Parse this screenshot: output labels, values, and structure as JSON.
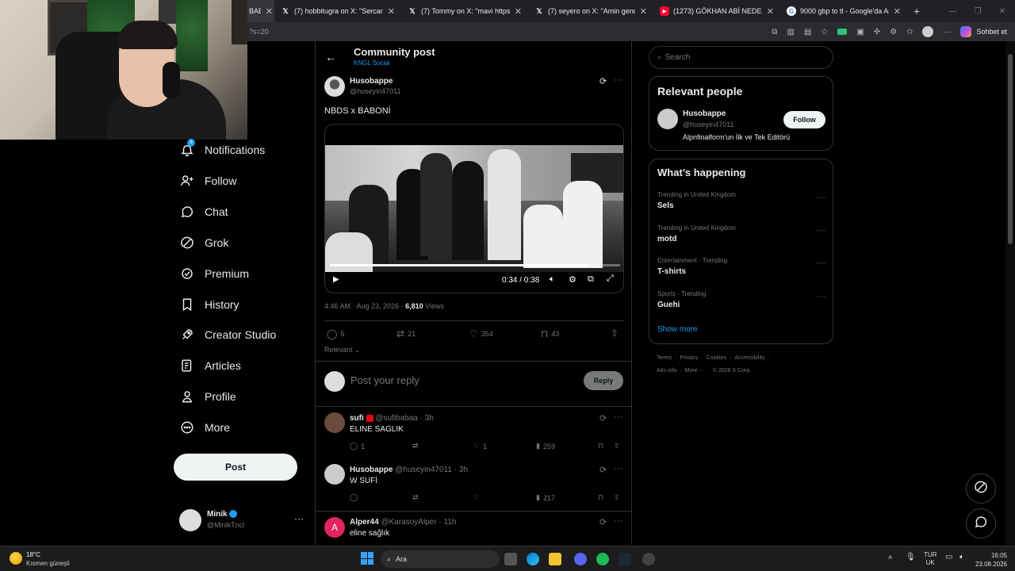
{
  "browser": {
    "tabs": [
      {
        "title": "BABO",
        "icon": "x"
      },
      {
        "title": "(7) hobbitugra on X: \"Sercantall ya",
        "icon": "x"
      },
      {
        "title": "(7) Tommy on X: \"mavi https://t.co",
        "icon": "x"
      },
      {
        "title": "(7) seyero on X: \"Amin gencler😂😂",
        "icon": "x"
      },
      {
        "title": "(1273) GÖKHAN ABİ NEDEN HAK",
        "icon": "youtube"
      },
      {
        "title": "9000 gbp to tl - Google'da Ara",
        "icon": "google"
      }
    ],
    "new_tab": "+",
    "url_fragment": "?s=20",
    "chat_label": "Sohbet et"
  },
  "sidebar": {
    "items": [
      {
        "label": "Notifications",
        "icon": "bell-icon"
      },
      {
        "label": "Follow",
        "icon": "person-plus-icon"
      },
      {
        "label": "Chat",
        "icon": "chat-icon"
      },
      {
        "label": "Grok",
        "icon": "grok-icon"
      },
      {
        "label": "Premium",
        "icon": "verified-icon"
      },
      {
        "label": "History",
        "icon": "bookmark-icon"
      },
      {
        "label": "Creator Studio",
        "icon": "rocket-icon"
      },
      {
        "label": "Articles",
        "icon": "article-icon"
      },
      {
        "label": "Profile",
        "icon": "person-icon"
      },
      {
        "label": "More",
        "icon": "more-circle-icon"
      }
    ],
    "post_button": "Post",
    "account": {
      "name": "Minik",
      "handle": "@MinikTncl"
    }
  },
  "header": {
    "title": "Community post",
    "subtitle": "KNGL Social"
  },
  "post": {
    "author": "Husobappe",
    "handle": "@huseyin47011",
    "text": "NBDS x BABONİ",
    "video": {
      "time": "0:34 / 0:38",
      "progress": 0.89
    },
    "timestamp": "4:46 AM · Aug 23, 2026 · ",
    "views_count": "6,810",
    "views_label": " Views",
    "stats": {
      "replies": "5",
      "reposts": "21",
      "likes": "354",
      "bookmarks": "43"
    },
    "sort_label": "Relevant"
  },
  "reply_box": {
    "placeholder": "Post your reply",
    "button": "Reply"
  },
  "replies": [
    {
      "name": "sufi",
      "handle": "@sufibabaa · 3h",
      "text": "ELINE SAGLIK",
      "replies": "1",
      "likes": "1",
      "views": "259"
    },
    {
      "name": "Husobappe",
      "handle": "@huseyin47011 · 3h",
      "text": "W SUFİ",
      "replies": "",
      "likes": "",
      "views": "217"
    },
    {
      "name": "Alper44",
      "handle": "@KarasoyAlper · 11h",
      "text": "eline sağlık",
      "avatar_letter": "A"
    }
  ],
  "search": {
    "placeholder": "Search"
  },
  "relevant_people": {
    "title": "Relevant people",
    "name": "Husobappe",
    "handle": "@huseyin47011",
    "bio": "Alpnfinalform'un İlk ve Tek Editörü",
    "follow": "Follow"
  },
  "happening": {
    "title": "What’s happening",
    "trends": [
      {
        "category": "Trending in United Kingdom",
        "name": "Sels"
      },
      {
        "category": "Trending in United Kingdom",
        "name": "motd"
      },
      {
        "category": "Entertainment · Trending",
        "name": "T-shirts"
      },
      {
        "category": "Sports · Trending",
        "name": "Guehi"
      }
    ],
    "show_more": "Show more"
  },
  "footer_links": {
    "row1": [
      "Terms",
      "Privacy",
      "Cookies",
      "Accessibility"
    ],
    "row2": [
      "Ads info",
      "More ···",
      "© 2026 X Corp."
    ]
  },
  "taskbar": {
    "weather_temp": "18°C",
    "weather_desc": "Kısmen güneşli",
    "search_label": "Ara",
    "lang1": "TUR",
    "lang2": "UK",
    "time": "16:05",
    "date": "23.08.2026"
  }
}
